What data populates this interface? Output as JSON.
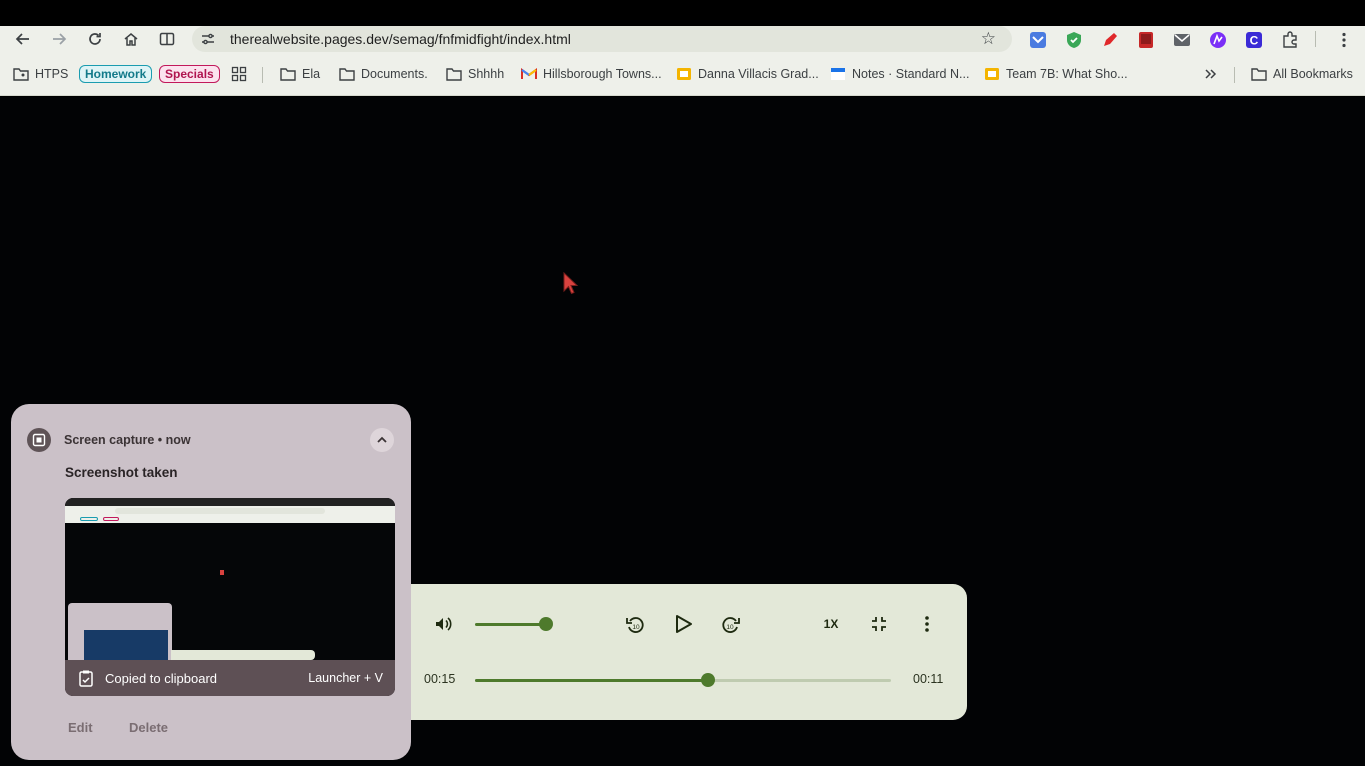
{
  "browser": {
    "url": "therealwebsite.pages.dev/semag/fnfmidfight/index.html"
  },
  "bookmarks": [
    {
      "label": "HTPS",
      "icon": "folder-shared-icon"
    },
    {
      "label": "Homework",
      "icon": "none"
    },
    {
      "label": "Specials",
      "icon": "none"
    },
    {
      "label": "Ela",
      "icon": "folder-icon"
    },
    {
      "label": "Documents.",
      "icon": "folder-icon"
    },
    {
      "label": "Shhhh",
      "icon": "folder-icon"
    },
    {
      "label": "Hillsborough Towns...",
      "icon": "gmail-icon"
    },
    {
      "label": "Danna Villacis Grad...",
      "icon": "slides-icon"
    },
    {
      "label": "Notes · Standard N...",
      "icon": "notes-icon"
    },
    {
      "label": "Team 7B: What Sho...",
      "icon": "slides-icon"
    },
    {
      "label": "All Bookmarks",
      "icon": "folder-icon"
    }
  ],
  "notification": {
    "app_title": "Screen capture • now",
    "headline": "Screenshot taken",
    "caption": "Copied to clipboard",
    "shortcut": "Launcher + V",
    "edit_label": "Edit",
    "delete_label": "Delete"
  },
  "player": {
    "elapsed": "00:15",
    "remaining": "00:11",
    "speed": "1X",
    "volume_fraction": 0.98,
    "progress_fraction": 0.56
  },
  "colors": {
    "accent": "#4e7a2c",
    "track_bg": "#bfcbb0",
    "player_bg": "#e3e8d8",
    "notif_bg": "#cbc1c8"
  }
}
